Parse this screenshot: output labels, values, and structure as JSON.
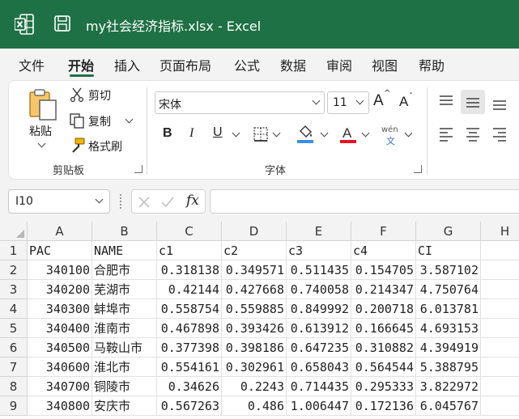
{
  "window": {
    "title": "my社会经济指标.xlsx  -  Excel"
  },
  "tabs": [
    "文件",
    "开始",
    "插入",
    "页面布局",
    "公式",
    "数据",
    "审阅",
    "视图",
    "帮助"
  ],
  "clipboard": {
    "paste": "粘贴",
    "cut": "剪切",
    "copy": "复制",
    "format_painter": "格式刷",
    "group": "剪贴板"
  },
  "font": {
    "name": "宋体",
    "size": "11",
    "group": "字体",
    "phonetic_top": "wén",
    "phonetic_bottom": "文"
  },
  "formula_bar": {
    "name_box": "I10",
    "fx": "fx",
    "formula": ""
  },
  "sheet": {
    "columns": [
      "A",
      "B",
      "C",
      "D",
      "E",
      "F",
      "G",
      "H"
    ],
    "rows": [
      {
        "n": "1",
        "cells": [
          "PAC",
          "NAME",
          "c1",
          "c2",
          "c3",
          "c4",
          "CI"
        ]
      },
      {
        "n": "2",
        "cells": [
          "340100",
          "合肥市",
          "0.318138",
          "0.349571",
          "0.511435",
          "0.154705",
          "3.587102"
        ]
      },
      {
        "n": "3",
        "cells": [
          "340200",
          "芜湖市",
          "0.42144",
          "0.427668",
          "0.740058",
          "0.214347",
          "4.750764"
        ]
      },
      {
        "n": "4",
        "cells": [
          "340300",
          "蚌埠市",
          "0.558754",
          "0.559885",
          "0.849992",
          "0.200718",
          "6.013781"
        ]
      },
      {
        "n": "5",
        "cells": [
          "340400",
          "淮南市",
          "0.467898",
          "0.393426",
          "0.613912",
          "0.166645",
          "4.693153"
        ]
      },
      {
        "n": "6",
        "cells": [
          "340500",
          "马鞍山市",
          "0.377398",
          "0.398186",
          "0.647235",
          "0.310882",
          "4.394919"
        ]
      },
      {
        "n": "7",
        "cells": [
          "340600",
          "淮北市",
          "0.554161",
          "0.302961",
          "0.658043",
          "0.564544",
          "5.388795"
        ]
      },
      {
        "n": "8",
        "cells": [
          "340700",
          "铜陵市",
          "0.34626",
          "0.2243",
          "0.714435",
          "0.295333",
          "3.822972"
        ]
      },
      {
        "n": "9",
        "cells": [
          "340800",
          "安庆市",
          "0.567263",
          "0.486",
          "1.006447",
          "0.172136",
          "6.045767"
        ]
      }
    ]
  },
  "colors": {
    "brand": "#1e7145",
    "font_color": "#e81123",
    "fill_color": "#3a8ee6"
  }
}
